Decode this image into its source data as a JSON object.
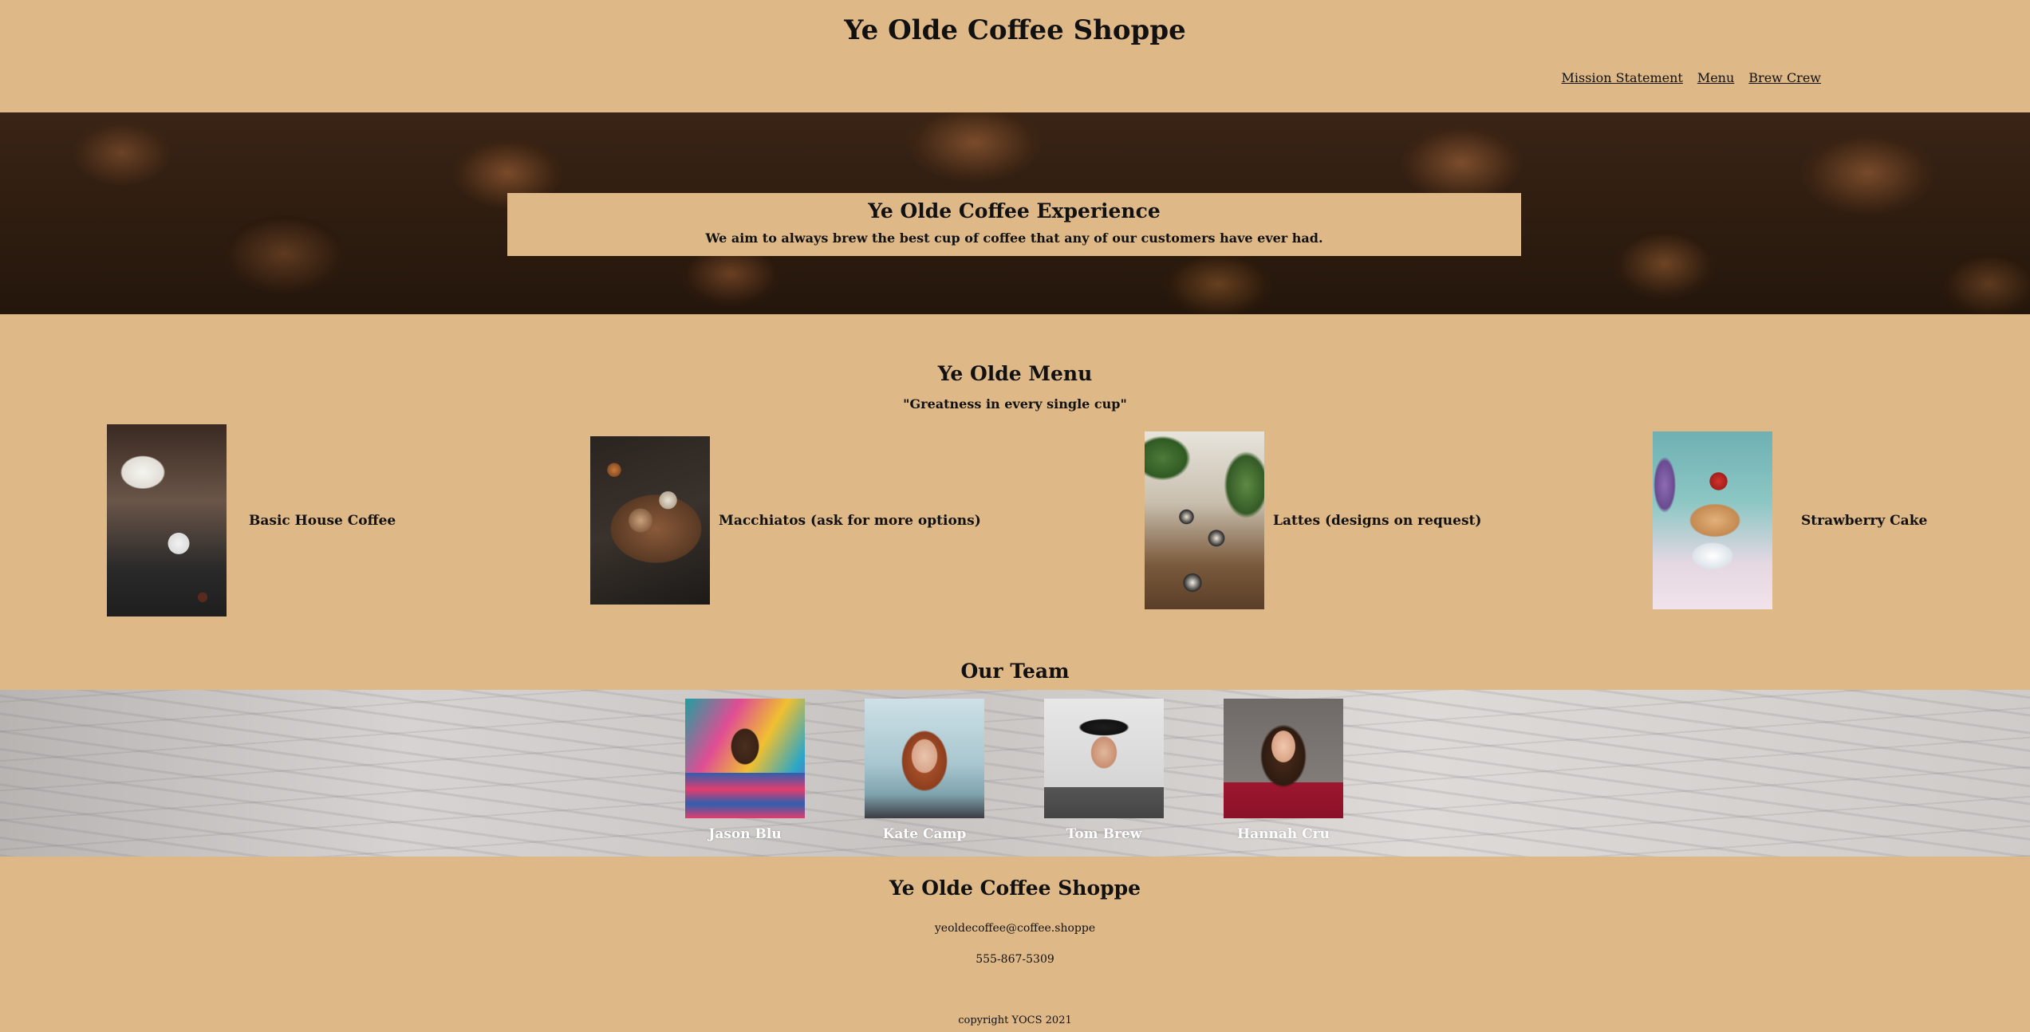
{
  "header": {
    "title": "Ye Olde Coffee Shoppe",
    "nav": [
      "Mission Statement",
      "Menu",
      "Brew Crew"
    ]
  },
  "hero": {
    "title": "Ye Olde Coffee Experience",
    "text": "We aim to always brew the best cup of coffee that any of our customers have ever had."
  },
  "menu": {
    "title": "Ye Olde Menu",
    "tagline": "\"Greatness in every single cup\"",
    "items": [
      {
        "label": "Basic House Coffee"
      },
      {
        "label": "Macchiatos (ask for more options)"
      },
      {
        "label": "Lattes (designs on request)"
      },
      {
        "label": "Strawberry Cake"
      }
    ]
  },
  "team": {
    "title": "Our Team",
    "members": [
      {
        "name": "Jason Blu"
      },
      {
        "name": "Kate Camp"
      },
      {
        "name": "Tom Brew"
      },
      {
        "name": "Hannah Cru"
      }
    ]
  },
  "footer": {
    "title": "Ye Olde Coffee Shoppe",
    "email": "yeoldecoffee@coffee.shoppe",
    "phone": "555-867-5309",
    "copyright": "copyright YOCS 2021"
  },
  "colors": {
    "background": "#deb887",
    "text": "#111111"
  }
}
